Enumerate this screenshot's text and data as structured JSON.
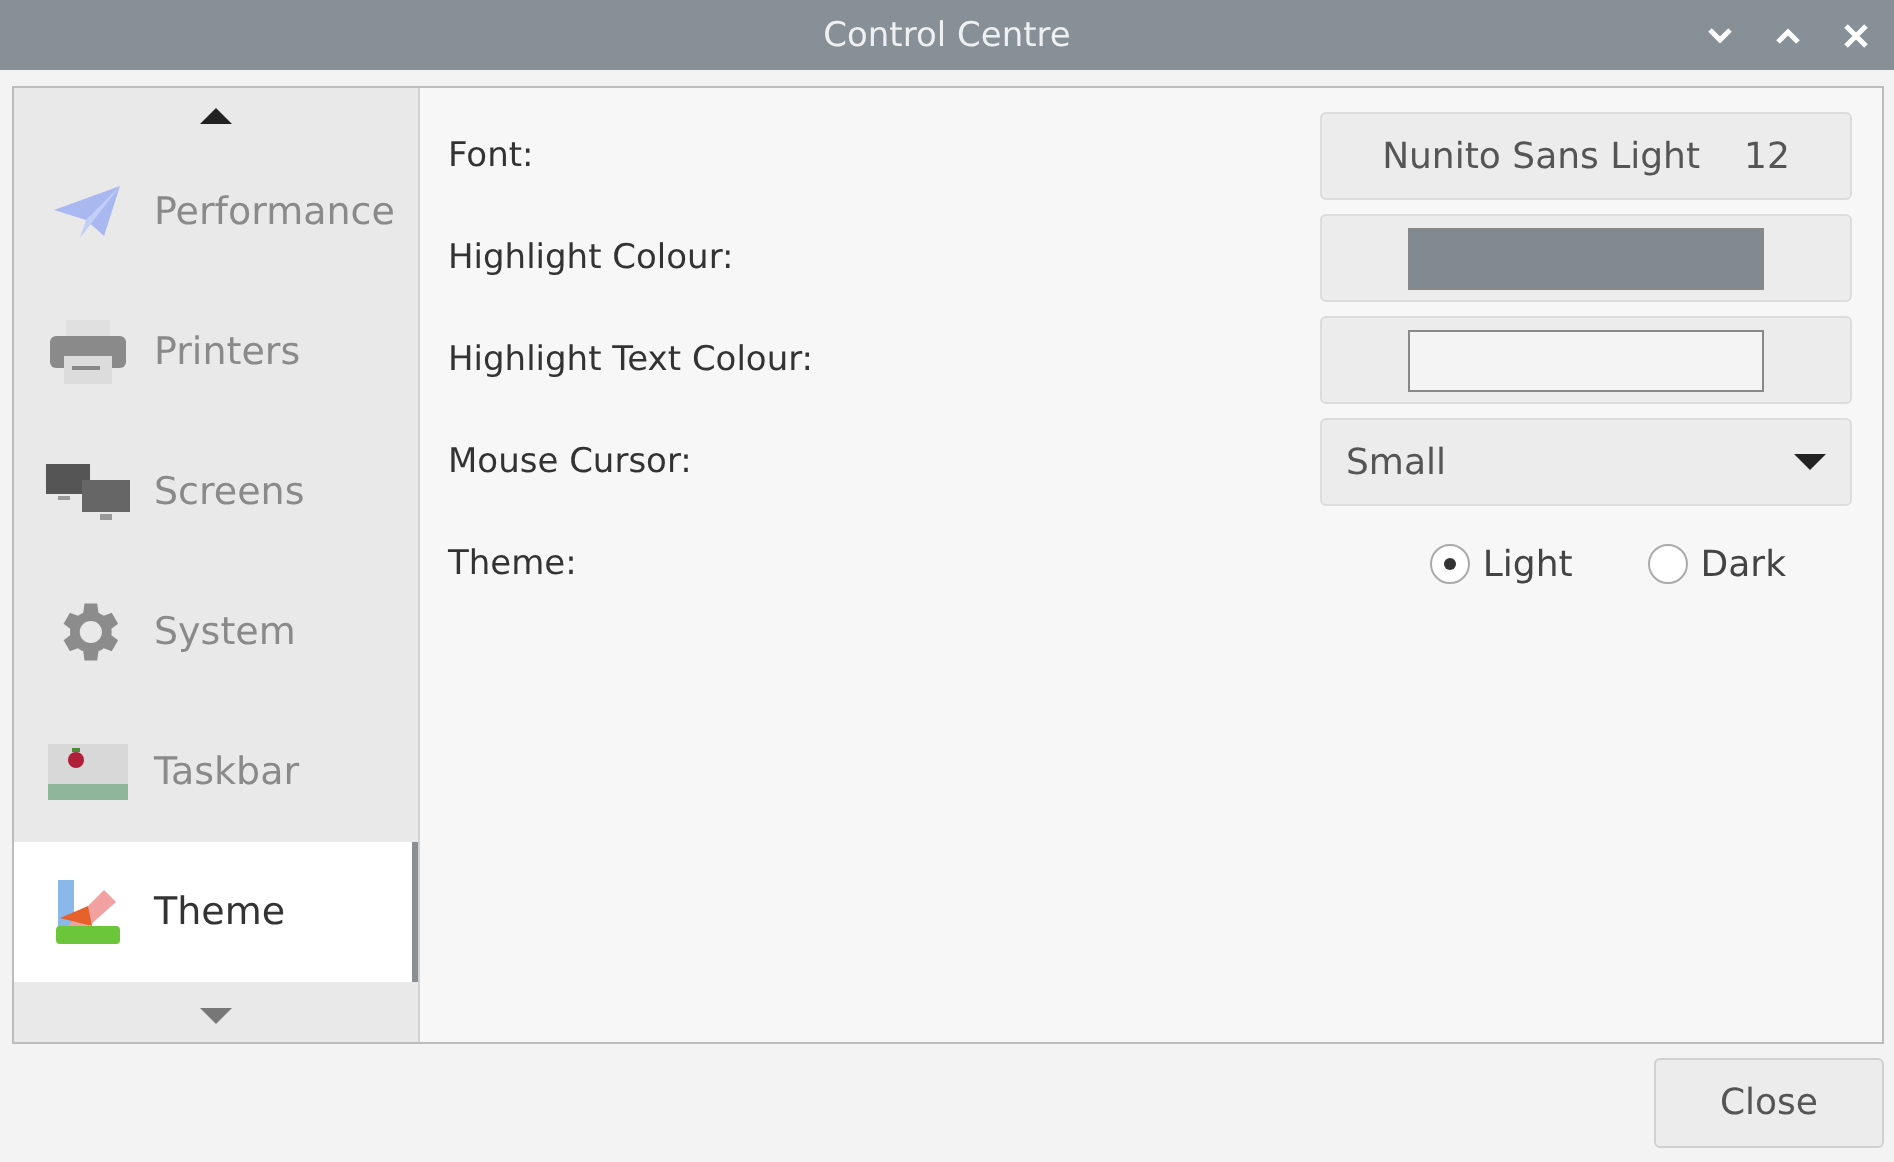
{
  "window": {
    "title": "Control Centre"
  },
  "sidebar": {
    "items": [
      {
        "label": "Performance",
        "kind": "plane",
        "selected": false
      },
      {
        "label": "Printers",
        "kind": "printer",
        "selected": false
      },
      {
        "label": "Screens",
        "kind": "screens",
        "selected": false
      },
      {
        "label": "System",
        "kind": "gear",
        "selected": false
      },
      {
        "label": "Taskbar",
        "kind": "taskbar",
        "selected": false
      },
      {
        "label": "Theme",
        "kind": "theme",
        "selected": true
      }
    ]
  },
  "settings": [
    {
      "kind": "font",
      "label": "Font:",
      "value": "Nunito Sans Light",
      "size": "12"
    },
    {
      "kind": "color",
      "label": "Highlight Colour:",
      "color": "#818991"
    },
    {
      "kind": "color",
      "label": "Highlight Text Colour:",
      "color": "#f4f4f4"
    },
    {
      "kind": "dropdown",
      "label": "Mouse Cursor:",
      "value": "Small"
    },
    {
      "kind": "radio",
      "label": "Theme:",
      "options": [
        {
          "label": "Light",
          "selected": true
        },
        {
          "label": "Dark",
          "selected": false
        }
      ]
    }
  ],
  "buttons": [
    "Close"
  ]
}
